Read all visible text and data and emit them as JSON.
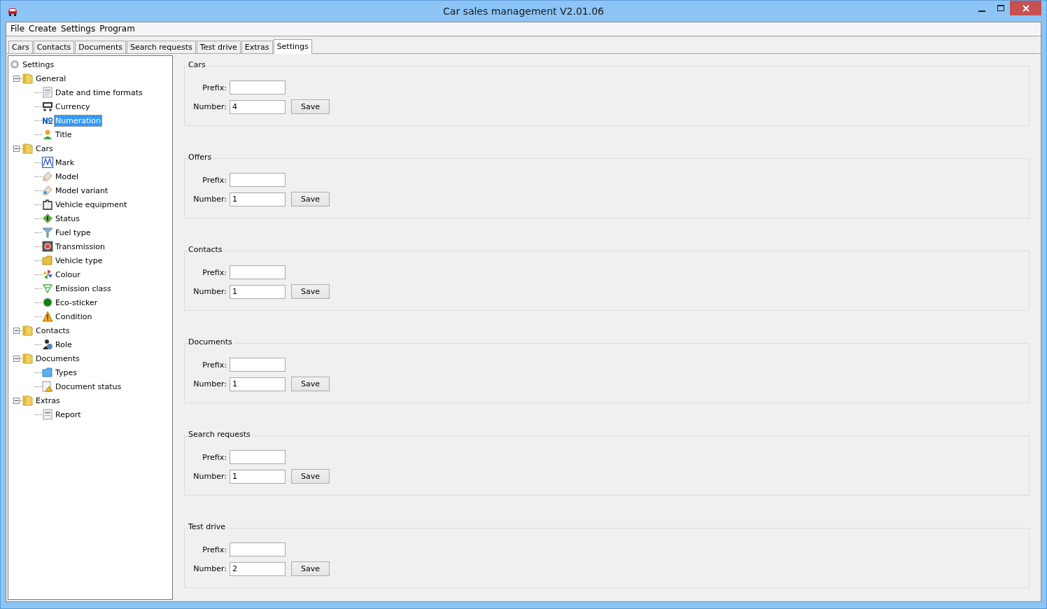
{
  "window": {
    "title": "Car sales management V2.01.06"
  },
  "menu": [
    "File",
    "Create",
    "Settings",
    "Program"
  ],
  "tabs": [
    {
      "label": "Cars",
      "selected": false
    },
    {
      "label": "Contacts",
      "selected": false
    },
    {
      "label": "Documents",
      "selected": false
    },
    {
      "label": "Search requests",
      "selected": false
    },
    {
      "label": "Test drive",
      "selected": false
    },
    {
      "label": "Extras",
      "selected": false
    },
    {
      "label": "Settings",
      "selected": true
    }
  ],
  "tree": {
    "label": "Settings",
    "selected": false,
    "children": [
      {
        "label": "General",
        "expanded": true,
        "selected": false,
        "children": [
          {
            "label": "Date and time formats",
            "kind": "calendar",
            "selected": false
          },
          {
            "label": "Currency",
            "kind": "currency",
            "selected": false
          },
          {
            "label": "Numeration",
            "kind": "numero",
            "selected": true
          },
          {
            "label": "Title",
            "kind": "person",
            "selected": false
          }
        ]
      },
      {
        "label": "Cars",
        "expanded": true,
        "selected": false,
        "children": [
          {
            "label": "Mark",
            "kind": "mark",
            "selected": false
          },
          {
            "label": "Model",
            "kind": "tag",
            "selected": false
          },
          {
            "label": "Model variant",
            "kind": "tag-variant",
            "selected": false
          },
          {
            "label": "Vehicle equipment",
            "kind": "equipment",
            "selected": false
          },
          {
            "label": "Status",
            "kind": "status",
            "selected": false
          },
          {
            "label": "Fuel type",
            "kind": "funnel",
            "selected": false
          },
          {
            "label": "Transmission",
            "kind": "transmission",
            "selected": false
          },
          {
            "label": "Vehicle type",
            "kind": "folder",
            "selected": false
          },
          {
            "label": "Colour",
            "kind": "colour",
            "selected": false
          },
          {
            "label": "Emission class",
            "kind": "emission",
            "selected": false
          },
          {
            "label": "Eco-sticker",
            "kind": "eco",
            "selected": false
          },
          {
            "label": "Condition",
            "kind": "warning",
            "selected": false
          }
        ]
      },
      {
        "label": "Contacts",
        "expanded": true,
        "selected": false,
        "children": [
          {
            "label": "Role",
            "kind": "role",
            "selected": false
          }
        ]
      },
      {
        "label": "Documents",
        "expanded": true,
        "selected": false,
        "children": [
          {
            "label": "Types",
            "kind": "types",
            "selected": false
          },
          {
            "label": "Document status",
            "kind": "doc-status",
            "selected": false
          }
        ]
      },
      {
        "label": "Extras",
        "expanded": true,
        "selected": false,
        "children": [
          {
            "label": "Report",
            "kind": "report",
            "selected": false
          }
        ]
      }
    ]
  },
  "sections": [
    {
      "title": "Cars",
      "prefix_label": "Prefix:",
      "number_label": "Number:",
      "number": "4",
      "button": "Save"
    },
    {
      "title": "Offers",
      "prefix_label": "Prefix:",
      "number_label": "Number:",
      "number": "1",
      "button": "Save"
    },
    {
      "title": "Contacts",
      "prefix_label": "Prefix:",
      "number_label": "Number:",
      "number": "1",
      "button": "Save"
    },
    {
      "title": "Documents",
      "prefix_label": "Prefix:",
      "number_label": "Number:",
      "number": "1",
      "button": "Save"
    },
    {
      "title": "Search requests",
      "prefix_label": "Prefix:",
      "number_label": "Number:",
      "number": "1",
      "button": "Save"
    },
    {
      "title": "Test drive",
      "prefix_label": "Prefix:",
      "number_label": "Number:",
      "number": "2",
      "button": "Save"
    }
  ]
}
